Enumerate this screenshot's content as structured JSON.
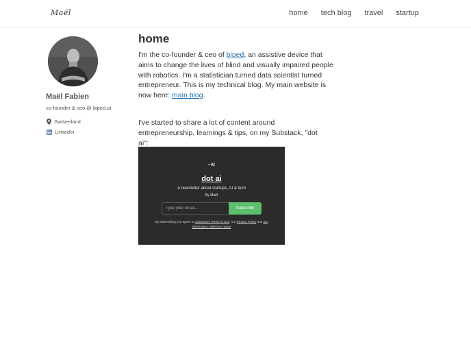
{
  "header": {
    "logo_text": "Maël",
    "nav": [
      "home",
      "tech blog",
      "travel",
      "startup"
    ]
  },
  "sidebar": {
    "name": "Maël Fabien",
    "bio": "co-founder & ceo @ biped.ai",
    "location": "Switzerland",
    "linkedin": "LinkedIn",
    "location_icon": "map-marker-icon",
    "linkedin_icon": "linkedin-icon"
  },
  "main": {
    "title": "home",
    "p1_before": "I'm the co-founder & ceo of ",
    "p1_link": "biped",
    "p1_middle": ", an assistive device that aims to change the lives of blind and visually impaired people with robotics. I'm a statistician turned data scientist turned entrepreneur. This is my technical blog. My main website is now here: ",
    "p1_link2": "main blog",
    "p1_after": ".",
    "p2": "I've started to share a lot of content around entrepreneurship, learnings & tips, on my Substack, \"dot ai\":"
  },
  "embed": {
    "logo": "• AI",
    "title": "dot ai",
    "description": "A newsletter about startups, AI & tech",
    "by": "By Maël",
    "input_placeholder": "Type your email...",
    "button": "Subscribe",
    "fine_before": "By subscribing you agree to ",
    "fine_link1": "Substack's Terms of Use",
    "fine_mid1": ", our ",
    "fine_link2": "Privacy Policy",
    "fine_mid2": " and ",
    "fine_link3": "our information collection notice",
    "background_color": "#2b2b2b",
    "button_color": "#5bbf6b"
  },
  "colors": {
    "link": "#1d6fb1",
    "text": "#333333"
  }
}
